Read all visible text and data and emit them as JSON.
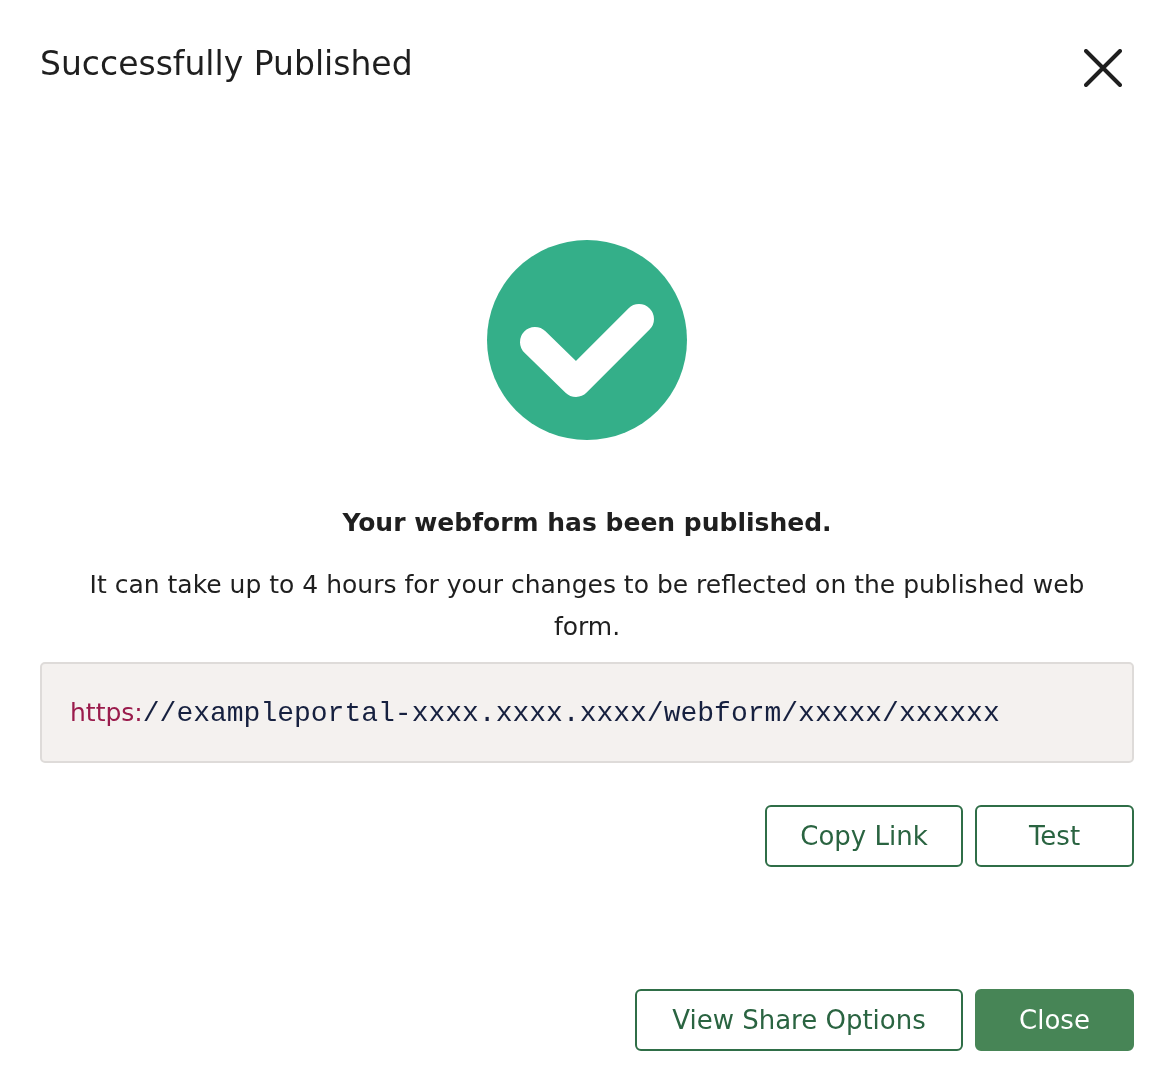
{
  "dialog": {
    "title": "Successfully Published"
  },
  "status": {
    "kind": "success",
    "heading": "Your webform has been published.",
    "message": "It can take up to 4 hours for your changes to be reflected on the published web form."
  },
  "link": {
    "scheme": "https:",
    "rest": "//exampleportal-xxxx.xxxx.xxxx/webform/xxxxx/xxxxxx"
  },
  "link_actions": [
    {
      "label": "Copy Link",
      "kind": "outline"
    },
    {
      "label": "Test",
      "kind": "outline"
    }
  ],
  "footer_buttons": [
    {
      "label": "View Share Options",
      "kind": "outline"
    },
    {
      "label": "Close",
      "kind": "primary"
    }
  ]
}
